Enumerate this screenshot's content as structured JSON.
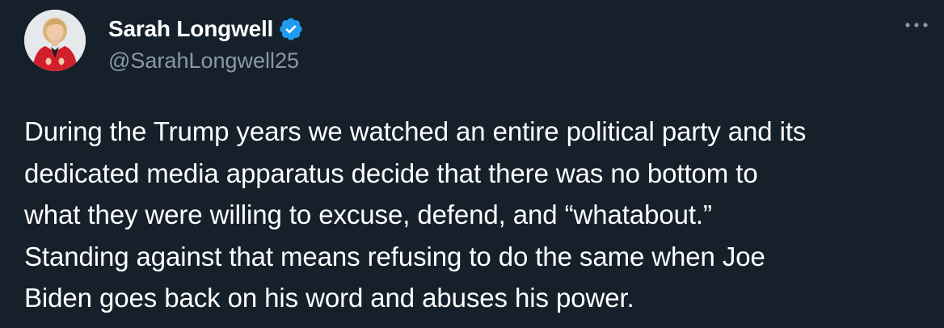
{
  "author": {
    "display_name": "Sarah Longwell",
    "handle": "@SarahLongwell25",
    "verified": true,
    "avatar_icon": "profile-photo"
  },
  "menu": {
    "icon": "more-horizontal-icon"
  },
  "tweet": {
    "lines": [
      "During the Trump years we watched an entire political party and its",
      "dedicated media apparatus decide that there was no bottom to",
      "what they were willing to excuse, defend, and “whatabout.”",
      "Standing against that means refusing to do the same when Joe",
      "Biden goes back on his word and abuses his power."
    ]
  },
  "colors": {
    "background": "#15202b",
    "text": "#ffffff",
    "secondary_text": "#8b98a5",
    "verified_badge": "#1d9bf0"
  }
}
